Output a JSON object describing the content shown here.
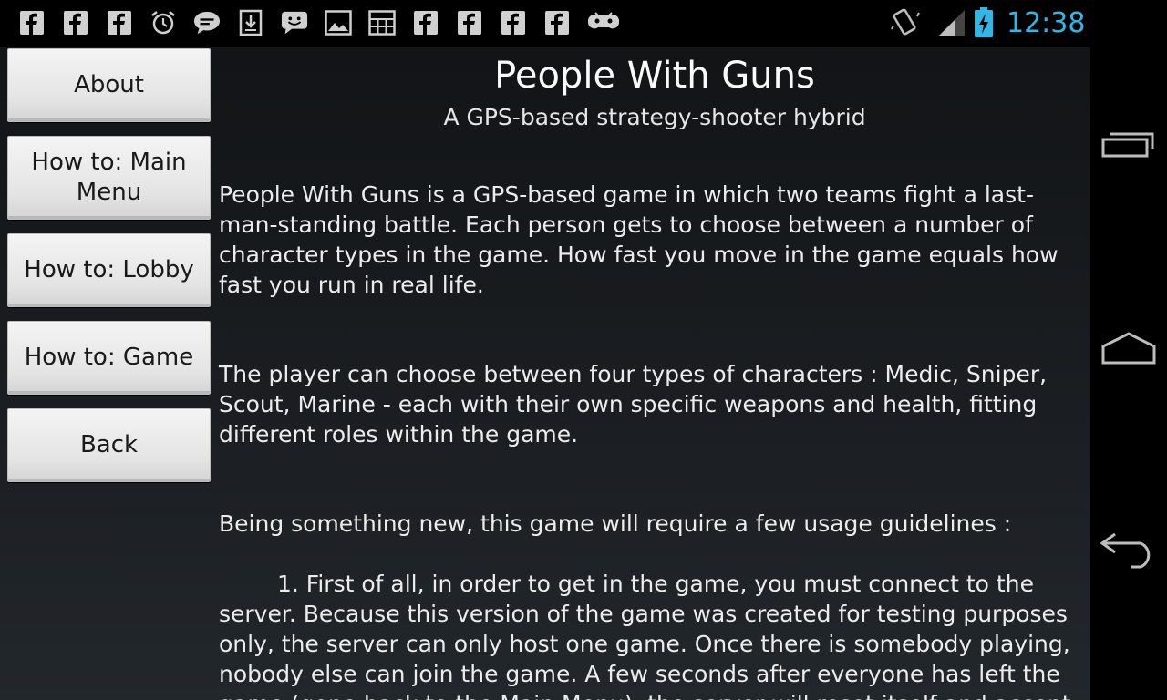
{
  "statusbar": {
    "left_icons": [
      "facebook-icon",
      "facebook-icon",
      "facebook-icon",
      "alarm-icon",
      "chat-bubble-icon",
      "download-icon",
      "smiley-message-icon",
      "image-icon",
      "calendar-grid-icon",
      "facebook-icon",
      "facebook-icon",
      "facebook-icon",
      "facebook-icon",
      "gamepad-icon"
    ],
    "right_icons": [
      "vibrate-icon",
      "signal-icon",
      "battery-charging-icon"
    ],
    "time": "12:38",
    "accent": "#33b5e5"
  },
  "menu": {
    "about_label": "About",
    "main_menu_label": "How to: Main Menu",
    "lobby_label": "How to: Lobby",
    "game_label": "How to: Game",
    "back_label": "Back"
  },
  "content": {
    "title": "People With Guns",
    "subtitle": "A GPS-based strategy-shooter hybrid",
    "paragraph1": "People With Guns is a GPS-based game in which two teams fight a last-man-standing battle. Each person gets to choose between a number of character types in the game. How fast you move in the game equals how fast you run in real life.",
    "paragraph2": "The player can choose between four types of characters : Medic, Sniper, Scout, Marine - each with their own specific weapons and health, fitting different roles within the game.",
    "paragraph3": "Being something new, this game will require a few usage guidelines :",
    "paragraph4": "1. First of all, in order to get in the game, you must connect to the server. Because this version of the game was created for testing purposes only, the server can only host one game. Once there is somebody playing, nobody else can join the game. A few seconds after everyone has left the game (gone back to the Main Menu), the server will reset itself and accept"
  },
  "navbar": {
    "icons": [
      "recent-apps-icon",
      "home-icon",
      "back-icon"
    ]
  }
}
